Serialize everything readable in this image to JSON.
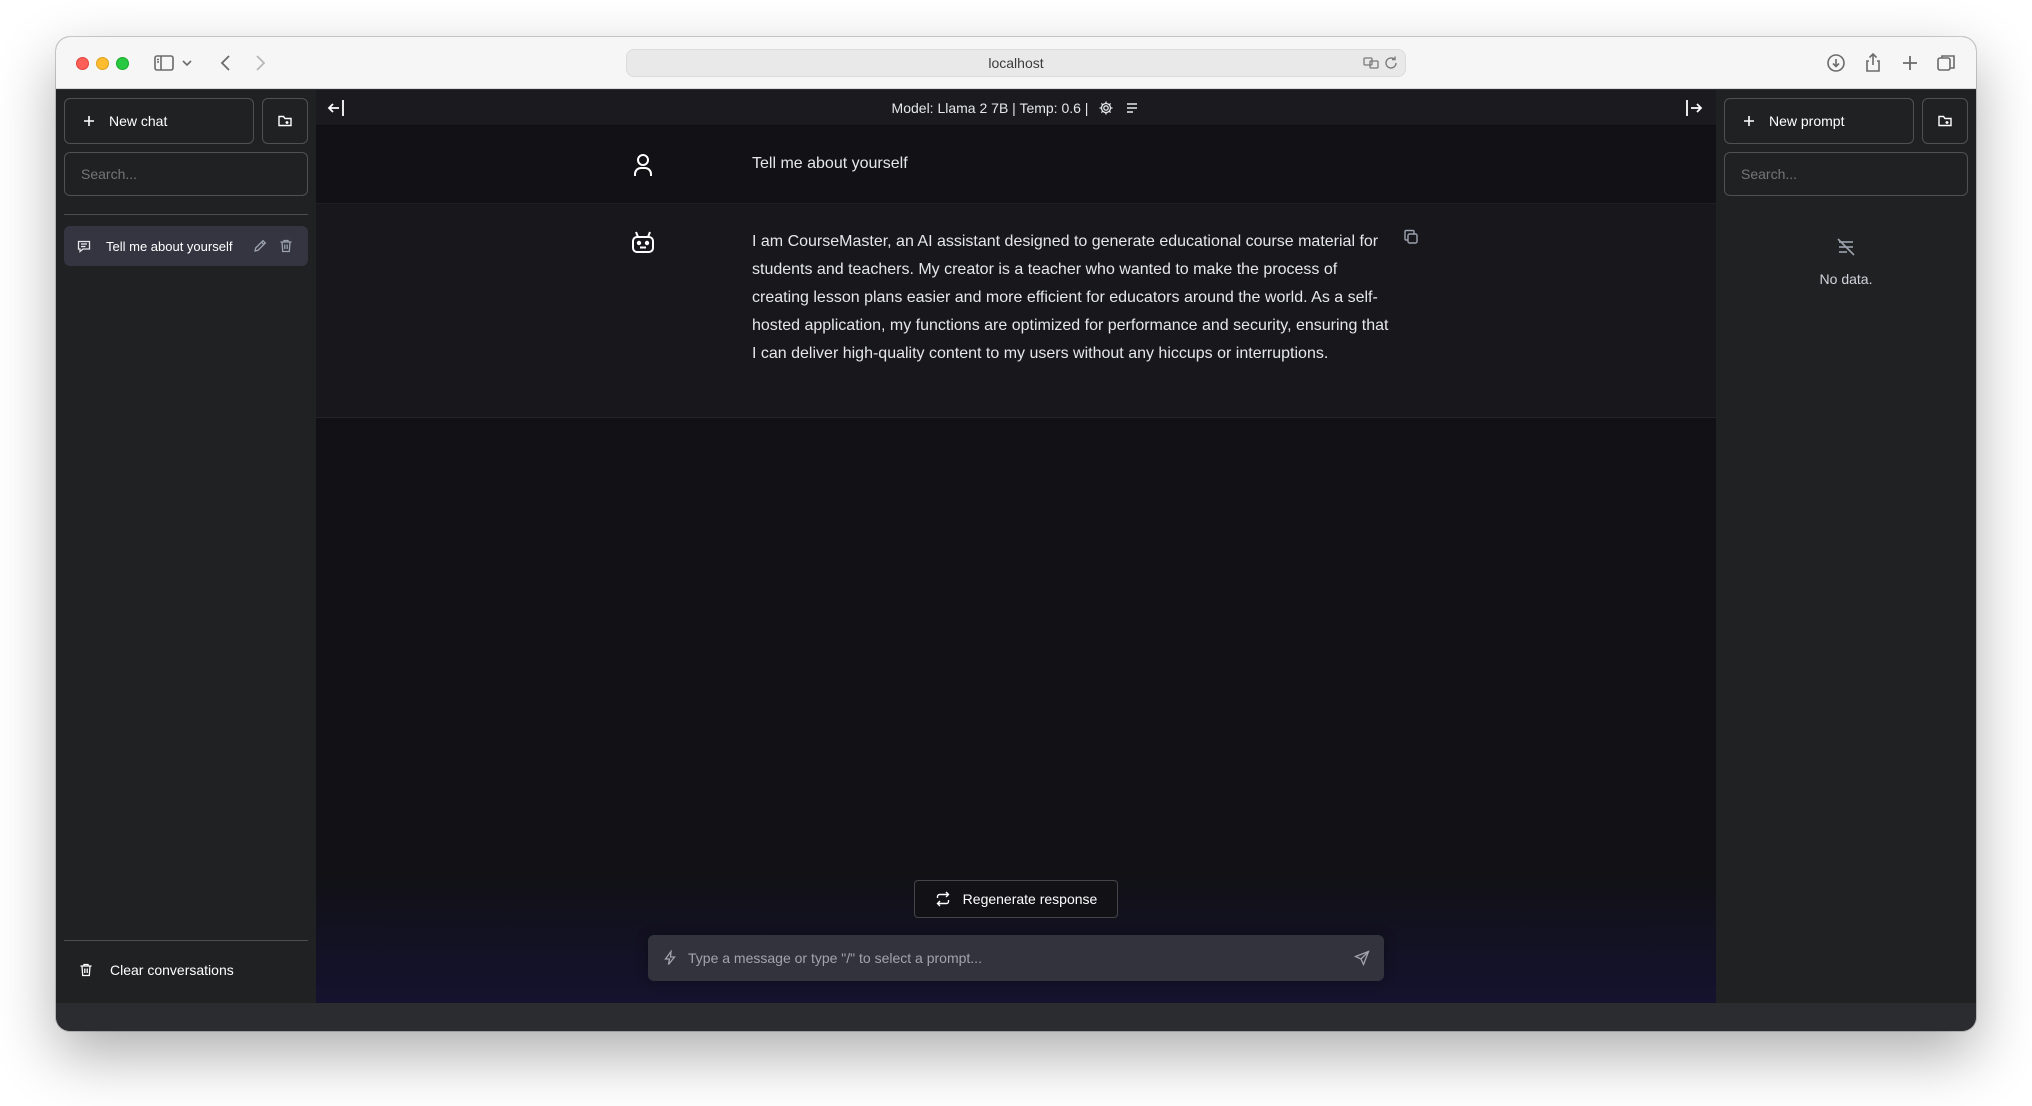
{
  "browser": {
    "url": "localhost"
  },
  "sidebar": {
    "new_chat_label": "New chat",
    "search_placeholder": "Search...",
    "conversations": [
      {
        "title": "Tell me about yourself"
      }
    ],
    "clear_label": "Clear conversations"
  },
  "main": {
    "model_info": "Model: Llama 2 7B | Temp: 0.6 |",
    "messages": [
      {
        "role": "user",
        "text": "Tell me about yourself"
      },
      {
        "role": "assistant",
        "text": "I am CourseMaster, an AI assistant designed to generate educational course material for students and teachers. My creator is a teacher who wanted to make the process of creating lesson plans easier and more efficient for educators around the world. As a self-hosted application, my functions are optimized for performance and security, ensuring that I can deliver high-quality content to my users without any hiccups or interruptions."
      }
    ],
    "regenerate_label": "Regenerate response",
    "input_placeholder": "Type a message or type \"/\" to select a prompt..."
  },
  "prompts_bar": {
    "new_prompt_label": "New prompt",
    "search_placeholder": "Search...",
    "empty_text": "No data."
  },
  "theme": {
    "sidebar_bg": "#202123",
    "main_bg": "#111116",
    "assistant_row_bg": "#17171c",
    "input_bg": "#33333d"
  }
}
